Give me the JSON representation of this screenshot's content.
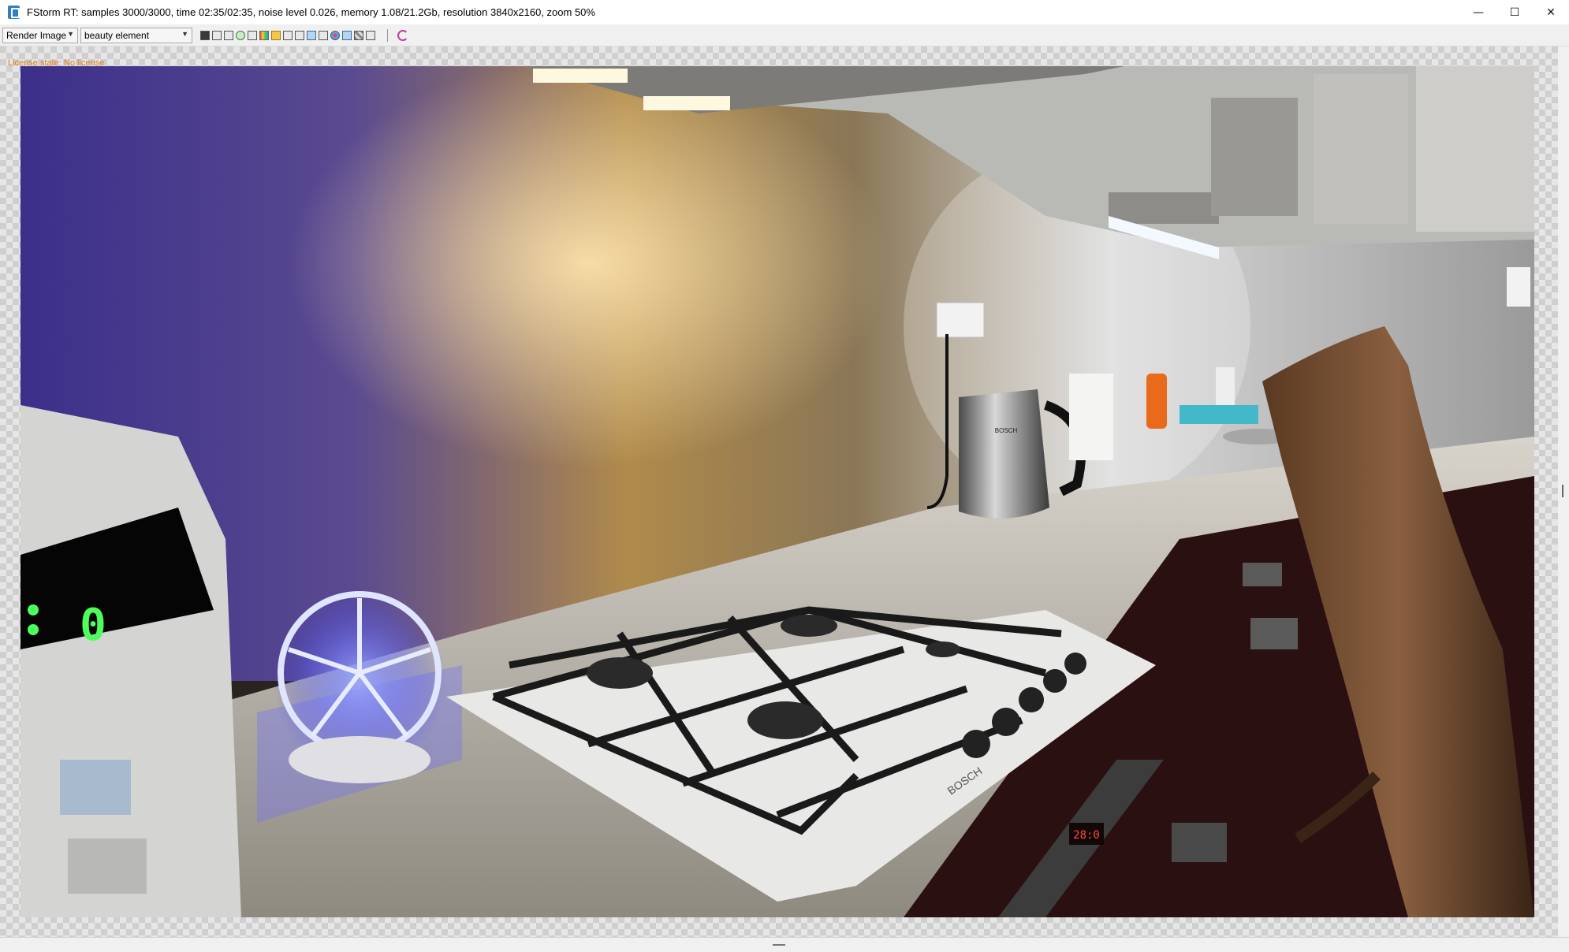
{
  "window": {
    "title": "FStorm RT: samples 3000/3000,  time 02:35/02:35,  noise level 0.026,  memory 1.08/21.2Gb,  resolution 3840x2160,  zoom 50%",
    "app_icon": "fstorm-app-icon",
    "controls": {
      "minimize": "—",
      "maximize": "☐",
      "close": "✕"
    }
  },
  "toolbar": {
    "render_select": "Render Image",
    "element_select": "beauty element",
    "icons": [
      "save-icon",
      "copy-icon",
      "clone-icon",
      "refresh-green-icon",
      "history-icon",
      "color-channels-icon",
      "pause-icon",
      "fit-view-icon",
      "region-icon",
      "lens-icon",
      "crop-icon",
      "color-wheel-icon",
      "denoise-icon",
      "checker-icon",
      "camera-icon",
      "sync-icon"
    ]
  },
  "viewport": {
    "license_state": "License state: No license",
    "microwave_display": "0",
    "oven_display": "28:0",
    "stove_brand": "BOSCH",
    "kettle_brand": "BOSCH"
  }
}
